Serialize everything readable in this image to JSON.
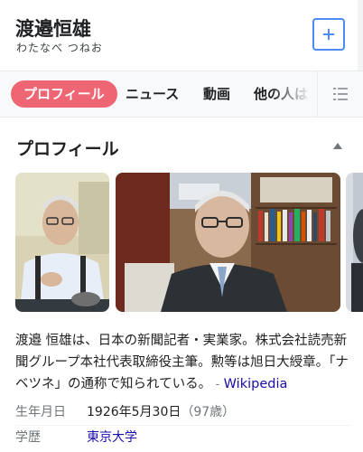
{
  "header": {
    "title": "渡邉恒雄",
    "reading": "わたなべ つねお"
  },
  "tabs": [
    {
      "label": "プロフィール",
      "active": true
    },
    {
      "label": "ニュース",
      "active": false
    },
    {
      "label": "動画",
      "active": false
    },
    {
      "label": "他の人はこ",
      "active": false
    }
  ],
  "profile": {
    "section_title": "プロフィール",
    "description": "渡邉 恒雄は、日本の新聞記者・実業家。株式会社読売新聞グループ本社代表取締役主筆。勲等は旭日大綬章。「ナベツネ」の通称で知られている。",
    "source_dash": "-",
    "source_label": "Wikipedia",
    "facts": [
      {
        "label": "生年月日",
        "value": "1926年5月30日",
        "extra": "（97歳）",
        "link": false
      },
      {
        "label": "学歴",
        "value": "東京大学",
        "extra": "",
        "link": true
      }
    ]
  },
  "colors": {
    "accent_tab": "#ee6673",
    "link": "#1a0dab",
    "add_border": "#4c8bf5"
  },
  "icons": [
    "plus-icon",
    "menu-list-icon",
    "collapse-arrow-icon"
  ]
}
